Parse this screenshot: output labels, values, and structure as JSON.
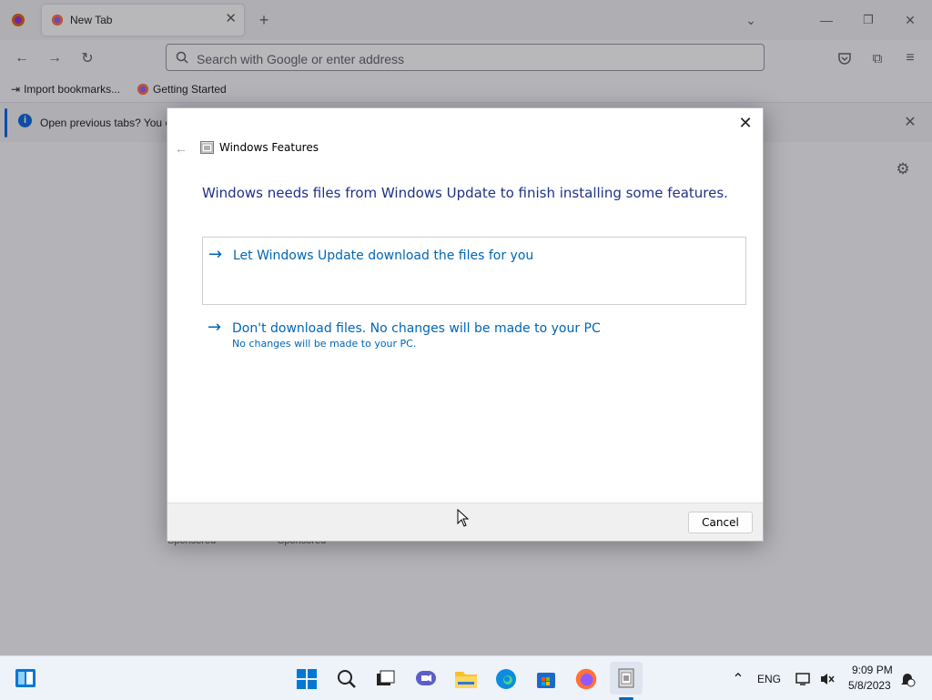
{
  "browser": {
    "tab_title": "New Tab",
    "url_placeholder": "Search with Google or enter address",
    "bookmarks": [
      "Import bookmarks...",
      "Getting Started"
    ],
    "notice_text": "Open previous tabs? You c",
    "sponsored": [
      "Sponsored",
      "Sponsored"
    ]
  },
  "dialog": {
    "title": "Windows Features",
    "heading": "Windows needs files from Windows Update to finish installing some features.",
    "option1": "Let Windows Update download the files for you",
    "option2_main": "Don't download files. No changes will be made to your PC",
    "option2_sub": "No changes will be made to your PC.",
    "cancel_label": "Cancel"
  },
  "taskbar": {
    "language": "ENG",
    "time": "9:09 PM",
    "date": "5/8/2023"
  },
  "colors": {
    "accent": "#0060df",
    "dialog_link": "#0066b4",
    "dialog_heading": "#1e3287"
  },
  "icons": [
    "firefox-icon",
    "plus-icon",
    "chevron-down-icon",
    "minimize-icon",
    "restore-icon",
    "close-icon",
    "back-icon",
    "forward-icon",
    "reload-icon",
    "search-icon",
    "pocket-icon",
    "extensions-icon",
    "menu-icon",
    "info-icon",
    "gear-icon",
    "windows-start-icon",
    "taskbar-search-icon",
    "task-view-icon",
    "chat-icon",
    "file-explorer-icon",
    "edge-icon",
    "store-icon",
    "windows-features-icon",
    "network-icon",
    "volume-icon",
    "notification-icon"
  ]
}
